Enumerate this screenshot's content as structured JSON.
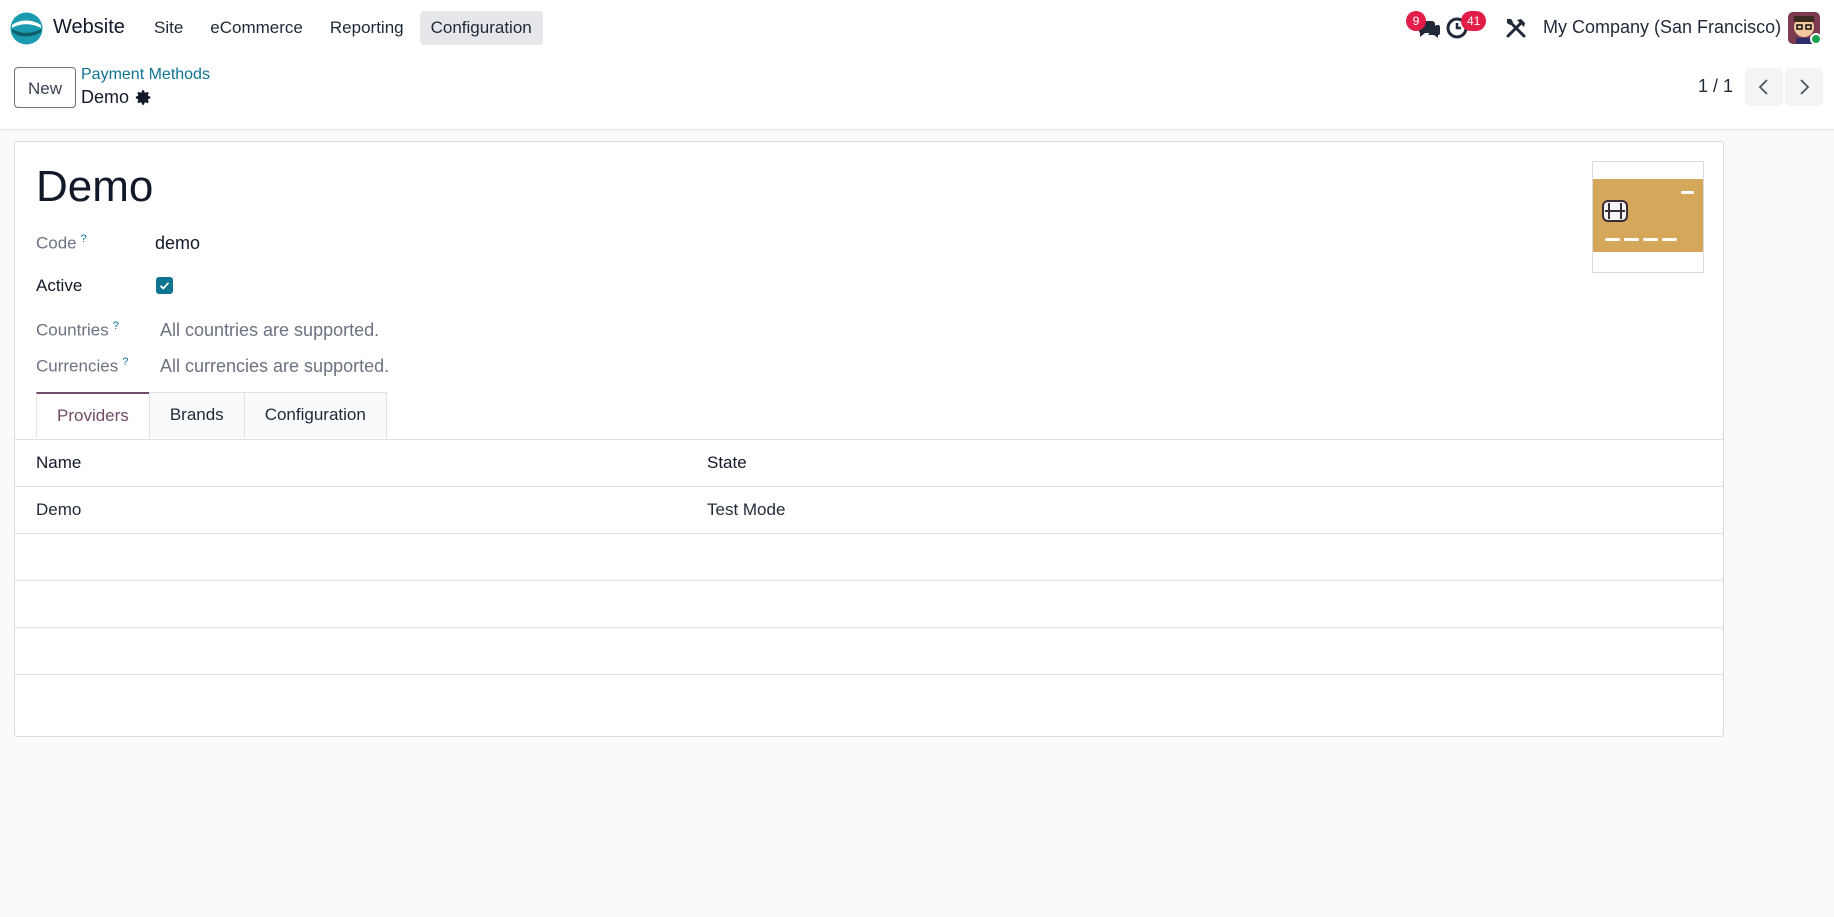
{
  "app": {
    "name": "Website",
    "menu": [
      "Site",
      "eCommerce",
      "Reporting",
      "Configuration"
    ],
    "active_menu": "Configuration"
  },
  "systray": {
    "messages_count": "9",
    "activities_count": "41",
    "company": "My Company (San Francisco)"
  },
  "control": {
    "new_label": "New",
    "breadcrumb_parent": "Payment Methods",
    "breadcrumb_current": "Demo",
    "pager_value": "1 / 1"
  },
  "form": {
    "title": "Demo",
    "code_label": "Code",
    "code_value": "demo",
    "active_label": "Active",
    "active_checked": true,
    "countries_label": "Countries",
    "countries_value": "All countries are supported.",
    "currencies_label": "Currencies",
    "currencies_value": "All currencies are supported.",
    "help_mark": "?"
  },
  "tabs": [
    "Providers",
    "Brands",
    "Configuration"
  ],
  "providers_table": {
    "columns": [
      "Name",
      "State"
    ],
    "rows": [
      [
        "Demo",
        "Test Mode"
      ]
    ]
  },
  "colors": {
    "accent": "#714b67",
    "link": "#0e7490",
    "badge": "#e11d48",
    "card": "#d4a75a"
  }
}
